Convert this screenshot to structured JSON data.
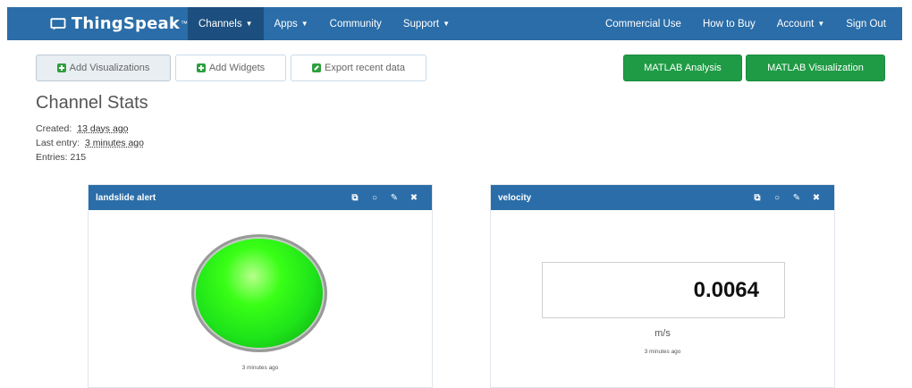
{
  "navbar": {
    "brand": "ThingSpeak",
    "brand_tm": "™",
    "left_items": [
      {
        "label": "Channels",
        "caret": true,
        "active": true
      },
      {
        "label": "Apps",
        "caret": true
      },
      {
        "label": "Community",
        "caret": false
      },
      {
        "label": "Support",
        "caret": true
      }
    ],
    "right_items": [
      {
        "label": "Commercial Use",
        "caret": false
      },
      {
        "label": "How to Buy",
        "caret": false
      },
      {
        "label": "Account",
        "caret": true
      },
      {
        "label": "Sign Out",
        "caret": false
      }
    ]
  },
  "toolbar": {
    "add_visualizations": "Add Visualizations",
    "add_widgets": "Add Widgets",
    "export_recent_data": "Export recent data",
    "matlab_analysis": "MATLAB Analysis",
    "matlab_visualization": "MATLAB Visualization"
  },
  "channel_stats": {
    "title": "Channel Stats",
    "created_label": "Created:",
    "created_value": "13 days ago",
    "last_entry_label": "Last entry:",
    "last_entry_value": "3 minutes ago",
    "entries_label": "Entries:",
    "entries_value": "215"
  },
  "widgets": [
    {
      "title": "landslide alert",
      "lamp_color": "#22e81c",
      "timestamp": "3 minutes ago"
    },
    {
      "title": "velocity",
      "value": "0.0064",
      "unit": "m/s",
      "timestamp": "3 minutes ago"
    }
  ],
  "colors": {
    "navbar": "#2a6da8",
    "navbar_active": "#1c4f7f",
    "matlab_button": "#1f9b45",
    "icon_green": "#2e9e3e"
  },
  "icons": [
    "chat-monitor-icon",
    "external-link-icon",
    "comment-icon",
    "pencil-icon",
    "close-icon",
    "plus-icon"
  ]
}
